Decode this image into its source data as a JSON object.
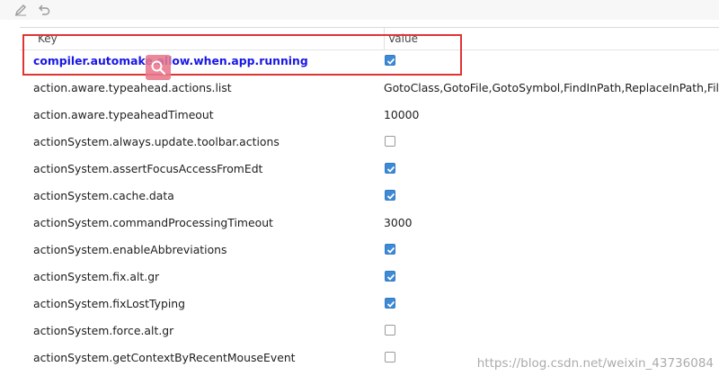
{
  "toolbar": {
    "edit_icon": "pencil-icon",
    "undo_icon": "undo-icon"
  },
  "table": {
    "headers": {
      "key": "Key",
      "value": "Value"
    },
    "rows": [
      {
        "key": "compiler.automake.allow.when.app.running",
        "type": "checkbox",
        "checked": true,
        "highlighted": true
      },
      {
        "key": "action.aware.typeahead.actions.list",
        "type": "text",
        "value": "GotoClass,GotoFile,GotoSymbol,FindInPath,ReplaceInPath,FileStr"
      },
      {
        "key": "action.aware.typeaheadTimeout",
        "type": "text",
        "value": "10000"
      },
      {
        "key": "actionSystem.always.update.toolbar.actions",
        "type": "checkbox",
        "checked": false
      },
      {
        "key": "actionSystem.assertFocusAccessFromEdt",
        "type": "checkbox",
        "checked": true
      },
      {
        "key": "actionSystem.cache.data",
        "type": "checkbox",
        "checked": true
      },
      {
        "key": "actionSystem.commandProcessingTimeout",
        "type": "text",
        "value": "3000"
      },
      {
        "key": "actionSystem.enableAbbreviations",
        "type": "checkbox",
        "checked": true
      },
      {
        "key": "actionSystem.fix.alt.gr",
        "type": "checkbox",
        "checked": true
      },
      {
        "key": "actionSystem.fixLostTyping",
        "type": "checkbox",
        "checked": true
      },
      {
        "key": "actionSystem.force.alt.gr",
        "type": "checkbox",
        "checked": false
      },
      {
        "key": "actionSystem.getContextByRecentMouseEvent",
        "type": "checkbox",
        "checked": false
      }
    ]
  },
  "overlay": {
    "search_icon": "search-icon"
  },
  "colors": {
    "highlight_border": "#e03434",
    "highlight_text": "#1717e6",
    "checkbox_on": "#3d8bd6"
  },
  "watermark": "https://blog.csdn.net/weixin_43736084"
}
